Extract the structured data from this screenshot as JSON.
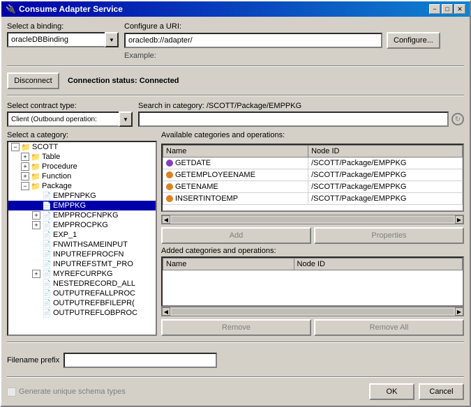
{
  "window": {
    "title": "Consume Adapter Service",
    "min_btn": "−",
    "max_btn": "□",
    "close_btn": "✕"
  },
  "binding": {
    "label": "Select a binding:",
    "value": "oracleDBBinding",
    "dropdown_arrow": "▼"
  },
  "uri": {
    "label": "Configure a URI:",
    "value": "oracledb://adapter/",
    "example_label": "Example:",
    "configure_btn": "Configure..."
  },
  "connection": {
    "disconnect_btn": "Disconnect",
    "status_label": "Connection status:",
    "status_value": "Connected"
  },
  "contract": {
    "label": "Select contract type:",
    "value": "Client (Outbound operation:",
    "dropdown_arrow": "▼"
  },
  "search": {
    "label": "Search in category: /SCOTT/Package/EMPPKG",
    "placeholder": "",
    "refresh_icon": "↻"
  },
  "category": {
    "label": "Select a category:",
    "tree": [
      {
        "id": "scott",
        "indent": 0,
        "expanded": true,
        "type": "folder",
        "label": "SCOTT"
      },
      {
        "id": "table",
        "indent": 1,
        "expanded": false,
        "type": "folder",
        "label": "Table"
      },
      {
        "id": "procedure",
        "indent": 1,
        "expanded": false,
        "type": "folder",
        "label": "Procedure"
      },
      {
        "id": "function",
        "indent": 1,
        "expanded": false,
        "type": "folder",
        "label": "Function"
      },
      {
        "id": "package",
        "indent": 1,
        "expanded": true,
        "type": "folder",
        "label": "Package"
      },
      {
        "id": "empfnpkg",
        "indent": 2,
        "expanded": false,
        "type": "item",
        "label": "EMPFNPKG"
      },
      {
        "id": "emppkg",
        "indent": 2,
        "expanded": false,
        "type": "item",
        "label": "EMPPKG",
        "selected": true
      },
      {
        "id": "empprocfnpkg",
        "indent": 2,
        "expanded": false,
        "type": "item",
        "label": "EMPPROCFNPKG"
      },
      {
        "id": "empprocpkg",
        "indent": 2,
        "expanded": false,
        "type": "item",
        "label": "EMPPROCPKG"
      },
      {
        "id": "exp1",
        "indent": 2,
        "expanded": false,
        "type": "item",
        "label": "EXP_1"
      },
      {
        "id": "fnwithsameinput",
        "indent": 2,
        "expanded": false,
        "type": "item",
        "label": "FNWITHSAMEINPUT"
      },
      {
        "id": "inputrefprocfn",
        "indent": 2,
        "expanded": false,
        "type": "item",
        "label": "INPUTREFPROCFN"
      },
      {
        "id": "inputrefstmt_pro",
        "indent": 2,
        "expanded": false,
        "type": "item",
        "label": "INPUTREFSTMT_PRO"
      },
      {
        "id": "myrefcurpkg",
        "indent": 2,
        "expanded": false,
        "type": "item",
        "label": "MYREFCURPKG"
      },
      {
        "id": "nestedrecord_all",
        "indent": 2,
        "expanded": false,
        "type": "item",
        "label": "NESTEDRECORD_ALL"
      },
      {
        "id": "outputrefallproc",
        "indent": 2,
        "expanded": false,
        "type": "item",
        "label": "OUTPUTREFALLPROC"
      },
      {
        "id": "outputrefbfilepr",
        "indent": 2,
        "expanded": false,
        "type": "item",
        "label": "OUTPUTREFBFILEPR("
      },
      {
        "id": "outputreflob",
        "indent": 2,
        "expanded": false,
        "type": "item",
        "label": "OUTPUTREFLOBPROC"
      }
    ]
  },
  "operations": {
    "label": "Available categories and operations:",
    "columns": [
      "Name",
      "Node ID"
    ],
    "rows": [
      {
        "name": "GETDATE",
        "node_id": "/SCOTT/Package/EMPPKG",
        "icon": "purple"
      },
      {
        "name": "GETEMPLOYEENAME",
        "node_id": "/SCOTT/Package/EMPPKG",
        "icon": "orange"
      },
      {
        "name": "GETENAME",
        "node_id": "/SCOTT/Package/EMPPKG",
        "icon": "orange"
      },
      {
        "name": "INSERTINTOEMP",
        "node_id": "/SCOTT/Package/EMPPKG",
        "icon": "orange"
      }
    ]
  },
  "buttons": {
    "add": "Add",
    "properties": "Properties",
    "remove": "Remove",
    "remove_all": "Remove All"
  },
  "added": {
    "label": "Added categories and operations:",
    "columns": [
      "Name",
      "Node ID"
    ],
    "rows": []
  },
  "filename": {
    "label": "Filename prefix",
    "value": ""
  },
  "bottom": {
    "generate_checkbox_label": "Generate unique schema types",
    "ok_btn": "OK",
    "cancel_btn": "Cancel"
  }
}
